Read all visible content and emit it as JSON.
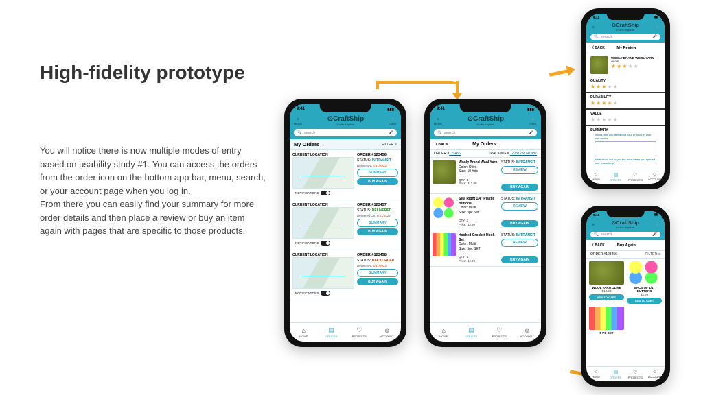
{
  "heading": "High-fidelity prototype",
  "body": "You will notice there is now multiple modes of entry based on usability study #1.  You can access the orders from the order icon on the bottom app bar, menu, search, or your account page when you log in.\nFrom there you can easily find your summary for more order details and then place a review or buy an item again with pages that are specific to those products.",
  "app": {
    "brand": "CraftShip",
    "tagline": "Crafts Anytime",
    "menu": "MENU",
    "cart": "CART",
    "search_placeholder": "search",
    "status_time": "9:41"
  },
  "bottombar": {
    "home": "HOME",
    "orders": "ORDERS",
    "projects": "PROJECTS",
    "account": "ACCOUNT"
  },
  "phone1": {
    "title": "My Orders",
    "filter": "FILTER",
    "current_loc": "CURRENT LOCATION",
    "notifications": "NOTIFICATIONS",
    "summary_btn": "SUMMARY",
    "buy_btn": "BUY AGAIN",
    "cards": [
      {
        "order": "ORDER #123456",
        "status_lbl": "STATUS:",
        "status": "IN TRANSIT",
        "status_cls": "transit",
        "date_lbl": "Deliver By:",
        "date": "7/31/2022"
      },
      {
        "order": "ORDER #123457",
        "status_lbl": "STATUS:",
        "status": "DELIVERED",
        "status_cls": "delivered",
        "date_lbl": "Delivered On:",
        "date": "6/31/2022"
      },
      {
        "order": "ORDER #123458",
        "status_lbl": "STATUS:",
        "status": "BACKORDER",
        "status_cls": "backorder",
        "date_lbl": "Deliver By:",
        "date": "8/31/2022"
      }
    ]
  },
  "phone2": {
    "back": "BACK",
    "title": "My Orders",
    "order_lbl": "ORDER #",
    "order_no": "123456",
    "track_lbl": "TRACKING #",
    "track_no": "1Z251238740987",
    "review_btn": "REVIEW",
    "buy_btn": "BUY AGAIN",
    "status_lbl": "STATUS:",
    "status": "IN TRANSIT",
    "items": [
      {
        "name": "Wooly Brand Wool Yarn",
        "color": "Color:  Olive",
        "size": "Size:  10 Yds",
        "qty": "QTY:  1",
        "price": "Price:  $12.99",
        "thumb": "th-yarn"
      },
      {
        "name": "Sew Right 1/4\" Plastic Buttons",
        "color": "Color:  Multi",
        "size": "Size:  5pc Set",
        "qty": "QTY:  3",
        "price": "Price:  $3.99",
        "thumb": "th-btn"
      },
      {
        "name": "Hooked Crochet Hook Set",
        "color": "Color:  Multi",
        "size": "Size:  5pc SET",
        "qty": "QTY:  1",
        "price": "Price:  $4.99",
        "thumb": "th-hook"
      }
    ]
  },
  "phone3": {
    "back": "BACK",
    "title": "My Review",
    "prod_name": "WOOLY BRAND WOOL YARN",
    "prod_color": "OLIVE",
    "sections": [
      {
        "label": "QUALITY",
        "stars": 3
      },
      {
        "label": "DURABILITY",
        "stars": 4
      },
      {
        "label": "VALUE",
        "stars": 0
      }
    ],
    "summary_lbl": "SUMMARY",
    "hint1": "Tell us how you feel about your product in your own words",
    "hint2": "What stood out to you the most when you opened your product up?"
  },
  "phone4": {
    "back": "BACK",
    "title": "Buy Again",
    "order_lbl": "ORDER #123456",
    "filter": "FILTER",
    "addcart": "ADD TO CART",
    "products": [
      {
        "name": "WOOL YARN OLIVE",
        "price": "$12.99",
        "thumb": "th-yarn"
      },
      {
        "name": "5 PCS OF 1/4\" BUTTONS",
        "price": "$3.99",
        "thumb": "th-btn"
      },
      {
        "name": "5 PC SET",
        "price": "",
        "thumb": "th-hook"
      }
    ]
  }
}
